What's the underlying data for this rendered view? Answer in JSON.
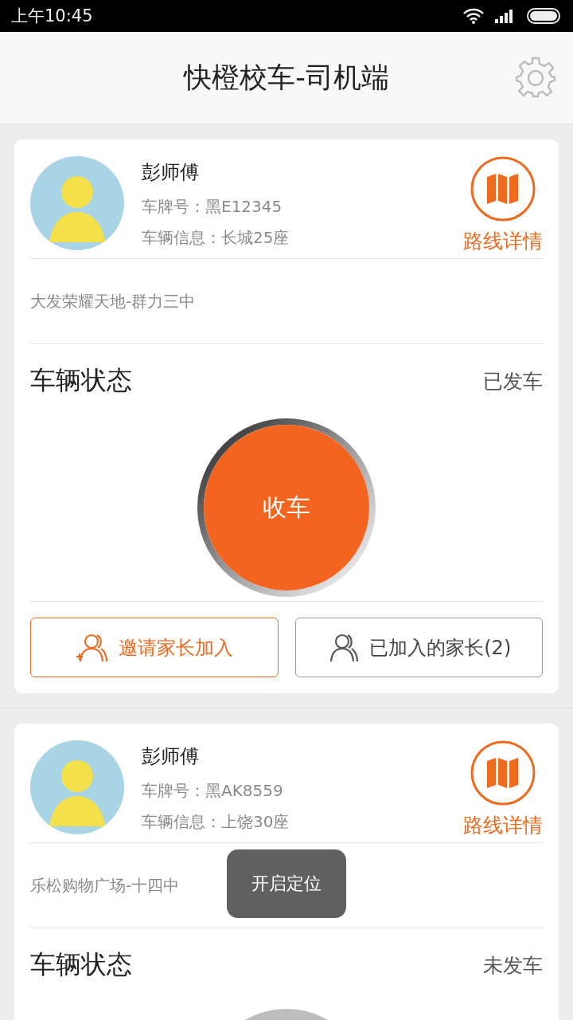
{
  "status_bar": {
    "time": "上午10:45"
  },
  "header": {
    "title": "快橙校车-司机端"
  },
  "cards": [
    {
      "driver": "彭师傅",
      "plate": "车牌号：黑E12345",
      "vehicle": "车辆信息：长城25座",
      "route_label": "路线详情",
      "route": "大发荣耀天地-群力三中",
      "status_title": "车辆状态",
      "status": "已发车",
      "action": {
        "label": "收车",
        "active": true
      },
      "buttons": [
        {
          "label": "邀请家长加入",
          "kind": "invite"
        },
        {
          "label": "已加入的家长(2)",
          "kind": "joined"
        }
      ]
    },
    {
      "driver": "彭师傅",
      "plate": "车牌号：黑AK8559",
      "vehicle": "车辆信息：上饶30座",
      "route_label": "路线详情",
      "route": "乐松购物广场-十四中",
      "status_title": "车辆状态",
      "status": "未发车",
      "action": {
        "active": false
      }
    }
  ],
  "toast": "开启定位"
}
